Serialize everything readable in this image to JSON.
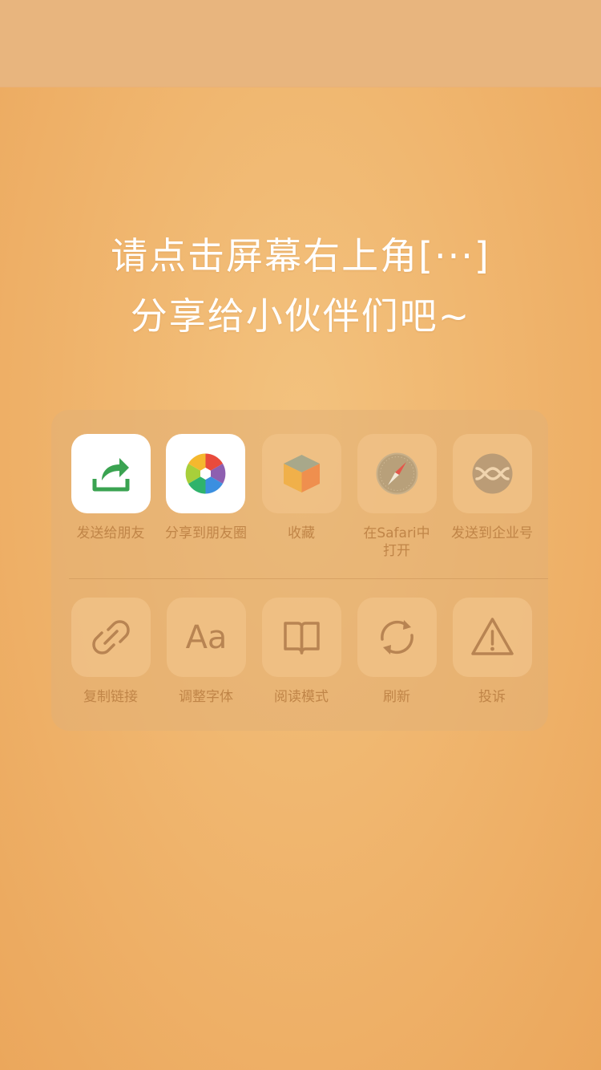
{
  "headline": {
    "line1": "请点击屏幕右上角[···]",
    "line2": "分享给小伙伴们吧~"
  },
  "share_sheet": {
    "row1": [
      {
        "label": "发送给朋友",
        "icon": "send-to-friend-icon"
      },
      {
        "label": "分享到朋友圈",
        "icon": "moments-icon"
      },
      {
        "label": "收藏",
        "icon": "favorites-cube-icon"
      },
      {
        "label": "在Safari中",
        "label2": "打开",
        "icon": "safari-compass-icon"
      },
      {
        "label": "发送到企业号",
        "icon": "enterprise-account-icon"
      }
    ],
    "row2": [
      {
        "label": "复制链接",
        "icon": "link-icon"
      },
      {
        "label": "调整字体",
        "icon": "font-size-icon",
        "glyph": "Aa"
      },
      {
        "label": "阅读模式",
        "icon": "book-icon"
      },
      {
        "label": "刷新",
        "icon": "refresh-icon"
      },
      {
        "label": "投诉",
        "icon": "warning-icon"
      }
    ]
  },
  "colors": {
    "background": "#efb36b",
    "top_bar": "#e8b57e",
    "label_text": "#c08548",
    "send_icon_green": "#3aa351"
  }
}
